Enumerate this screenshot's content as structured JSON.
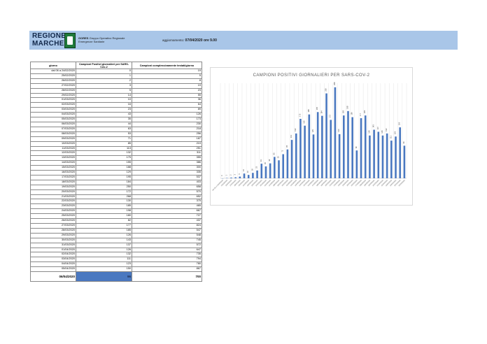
{
  "header": {
    "logo_line1": "REGIONE",
    "logo_line2": "MARCHE",
    "gores_title": "GORES",
    "gores_sub1": "Gruppo Operativo Regionale",
    "gores_sub2": "Emergenze Sanitarie",
    "update_label": "aggiornamento:",
    "update_value": "07/04/2020 ore 9.00",
    "brand_color": "#a9c6e8"
  },
  "table": {
    "col1": "giorno",
    "col2": "Campioni Positivi giornalieri per SARS-Cov-2",
    "col3": "Campioni complessivamente testati/giorno",
    "rows": [
      [
        "dal 06 a 24/02/2020",
        "0",
        "19"
      ],
      [
        "25/02/2020",
        "1",
        "5"
      ],
      [
        "26/02/2020",
        "2",
        "8"
      ],
      [
        "27/02/2020",
        "3",
        "19"
      ],
      [
        "28/02/2020",
        "5",
        "23"
      ],
      [
        "29/02/2020",
        "14",
        "55"
      ],
      [
        "01/03/2020",
        "10",
        "36"
      ],
      [
        "02/03/2020",
        "16",
        "64"
      ],
      [
        "03/03/2020",
        "23",
        "89"
      ],
      [
        "04/03/2020",
        "43",
        "126"
      ],
      [
        "05/03/2020",
        "35",
        "173"
      ],
      [
        "06/03/2020",
        "44",
        "230"
      ],
      [
        "07/03/2020",
        "63",
        "218"
      ],
      [
        "08/03/2020",
        "53",
        "256"
      ],
      [
        "09/03/2020",
        "71",
        "187"
      ],
      [
        "10/03/2020",
        "85",
        "219"
      ],
      [
        "11/03/2020",
        "113",
        "251"
      ],
      [
        "12/03/2020",
        "132",
        "311"
      ],
      [
        "13/03/2020",
        "175",
        "355"
      ],
      [
        "14/03/2020",
        "155",
        "386"
      ],
      [
        "15/03/2020",
        "188",
        "300"
      ],
      [
        "16/03/2020",
        "129",
        "335"
      ],
      [
        "17/03/2020",
        "195",
        "537"
      ],
      [
        "18/03/2020",
        "184",
        "403"
      ],
      [
        "19/03/2020",
        "250",
        "658"
      ],
      [
        "20/03/2020",
        "172",
        "570"
      ],
      [
        "21/03/2020",
        "268",
        "652"
      ],
      [
        "22/03/2020",
        "130",
        "375"
      ],
      [
        "23/03/2020",
        "185",
        "465"
      ],
      [
        "24/03/2020",
        "198",
        "667"
      ],
      [
        "25/03/2020",
        "180",
        "727"
      ],
      [
        "26/03/2020",
        "82",
        "437"
      ],
      [
        "27/03/2020",
        "177",
        "824"
      ],
      [
        "28/03/2020",
        "185",
        "547"
      ],
      [
        "29/03/2020",
        "126",
        "548"
      ],
      [
        "30/03/2020",
        "143",
        "745"
      ],
      [
        "31/03/2020",
        "137",
        "572"
      ],
      [
        "01/04/2020",
        "126",
        "647"
      ],
      [
        "02/04/2020",
        "132",
        "735"
      ],
      [
        "03/04/2020",
        "111",
        "794"
      ],
      [
        "04/04/2020",
        "123",
        "780"
      ],
      [
        "05/04/2020",
        "150",
        "867"
      ]
    ],
    "total_row": [
      "06/04/2020",
      "96",
      "700"
    ]
  },
  "chart_data": {
    "type": "bar",
    "title": "CAMPIONI POSITIVI GIORNALIERI PER SARS-COV-2",
    "bar_color": "#4a78c0",
    "grid": true,
    "categories": [
      "dal 06 a 24/02/2020",
      "25/02/2020",
      "26/02/2020",
      "27/02/2020",
      "28/02/2020",
      "29/02/2020",
      "01/03/2020",
      "02/03/2020",
      "03/03/2020",
      "04/03/2020",
      "05/03/2020",
      "06/03/2020",
      "07/03/2020",
      "08/03/2020",
      "09/03/2020",
      "10/03/2020",
      "11/03/2020",
      "12/03/2020",
      "13/03/2020",
      "14/03/2020",
      "15/03/2020",
      "16/03/2020",
      "17/03/2020",
      "18/03/2020",
      "19/03/2020",
      "20/03/2020",
      "21/03/2020",
      "22/03/2020",
      "23/03/2020",
      "24/03/2020",
      "25/03/2020",
      "26/03/2020",
      "27/03/2020",
      "28/03/2020",
      "29/03/2020",
      "30/03/2020",
      "31/03/2020",
      "01/04/2020",
      "02/04/2020",
      "03/04/2020",
      "04/04/2020",
      "05/04/2020",
      "06/04/2020"
    ],
    "values": [
      0,
      1,
      2,
      3,
      5,
      14,
      10,
      16,
      23,
      43,
      35,
      44,
      63,
      53,
      71,
      85,
      113,
      132,
      175,
      155,
      188,
      129,
      195,
      184,
      250,
      172,
      268,
      130,
      185,
      198,
      180,
      82,
      177,
      185,
      126,
      143,
      137,
      126,
      132,
      111,
      123,
      150,
      96
    ],
    "ylim": [
      0,
      280
    ]
  }
}
